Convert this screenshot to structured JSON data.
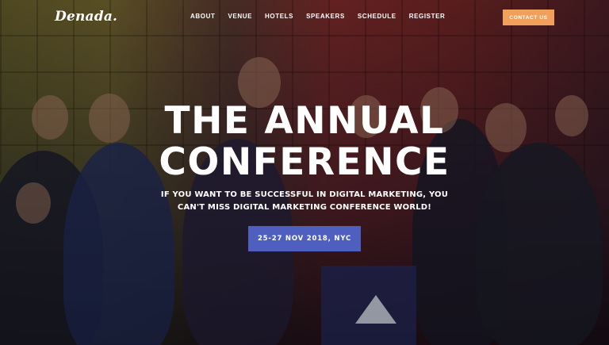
{
  "brand": {
    "logo_text": "Denada."
  },
  "nav": {
    "items": [
      {
        "label": "ABOUT"
      },
      {
        "label": "VENUE"
      },
      {
        "label": "HOTELS"
      },
      {
        "label": "SPEAKERS"
      },
      {
        "label": "SCHEDULE"
      },
      {
        "label": "REGISTER"
      }
    ],
    "cta_label": "CONTACT US"
  },
  "hero": {
    "title_line1": "THE ANNUAL",
    "title_line2": "CONFERENCE",
    "subtitle_line1": "IF YOU WANT TO BE SUCCESSFUL IN DIGITAL MARKETING, YOU",
    "subtitle_line2": "CAN'T MISS DIGITAL MARKETING CONFERENCE WORLD!",
    "date_button_label": "25-27 NOV 2018, NYC"
  },
  "colors": {
    "cta": "#f0a05a",
    "date_button": "#4f5fc0",
    "text": "#ffffff"
  }
}
